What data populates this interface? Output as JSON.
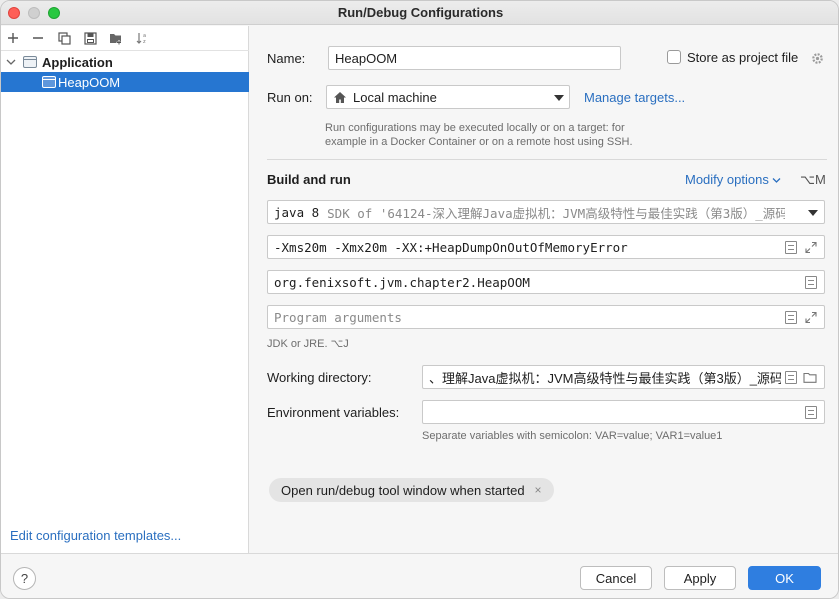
{
  "window": {
    "title": "Run/Debug Configurations"
  },
  "left": {
    "toolbar": [
      "add-icon",
      "remove-icon",
      "copy-icon",
      "save-icon",
      "new-folder-icon",
      "sort-icon"
    ],
    "tree": [
      {
        "label": "Application",
        "expanded": true
      },
      {
        "label": "HeapOOM",
        "selected": true
      }
    ],
    "edit_templates": "Edit configuration templates..."
  },
  "form": {
    "name_label": "Name:",
    "name_value": "HeapOOM",
    "store_label": "Store as project file",
    "run_on_label": "Run on:",
    "run_on_value": "Local machine",
    "manage_targets": "Manage targets...",
    "run_on_hint_1": "Run configurations may be executed locally or on a target: for",
    "run_on_hint_2": "example in a Docker Container or on a remote host using SSH.",
    "build_run_title": "Build and run",
    "modify_options": "Modify options",
    "modify_shortcut": "⌥M",
    "jdk_value": "java 8",
    "jdk_detail": "SDK of '64124-深入理解Java虚拟机：JVM高级特性与最佳实践（第3版）_源码",
    "vm_options": "-Xms20m -Xmx20m -XX:+HeapDumpOnOutOfMemoryError",
    "main_class": "org.fenixsoft.jvm.chapter2.HeapOOM",
    "program_args_placeholder": "Program arguments",
    "jdk_hint": "JDK or JRE. ⌥J",
    "working_dir_label": "Working directory:",
    "working_dir_value": "、理解Java虚拟机：JVM高级特性与最佳实践（第3版）_源码",
    "env_label": "Environment variables:",
    "env_value": "",
    "env_hint": "Separate variables with semicolon: VAR=value; VAR1=value1",
    "chip_label": "Open run/debug tool window when started",
    "chip_close": "×"
  },
  "footer": {
    "help": "?",
    "cancel": "Cancel",
    "apply": "Apply",
    "ok": "OK"
  },
  "colors": {
    "accent": "#2f7ee0",
    "selection": "#2676d1",
    "link": "#2a6fc0"
  }
}
